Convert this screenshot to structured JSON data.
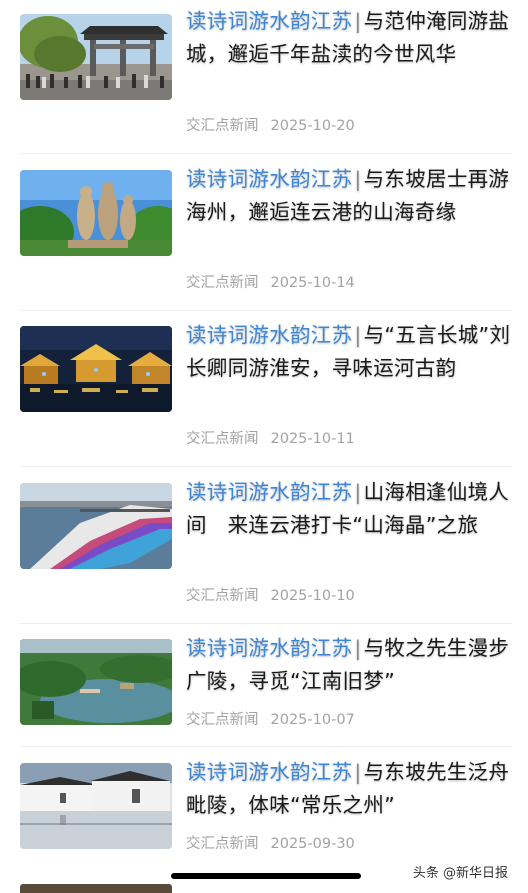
{
  "articles": [
    {
      "series": "读诗词游水韵江苏",
      "separator": "|",
      "title": "与范仲淹同游盐城，邂逅千年盐渎的今世风华",
      "source": "交汇点新闻",
      "date": "2025-10-20",
      "thumb_icon": "memorial-archway-image"
    },
    {
      "series": "读诗词游水韵江苏",
      "separator": "|",
      "title": "与东坡居士再游海州，邂逅连云港的山海奇缘",
      "source": "交汇点新闻",
      "date": "2025-10-14",
      "thumb_icon": "statue-park-image"
    },
    {
      "series": "读诗词游水韵江苏",
      "separator": "|",
      "title": "与“五言长城”刘长卿同游淮安，寻味运河古韵",
      "source": "交汇点新闻",
      "date": "2025-10-11",
      "thumb_icon": "night-canal-town-image"
    },
    {
      "series": "读诗词游水韵江苏",
      "separator": "|",
      "title": "山海相逢仙境人间　来连云港打卡“山海晶”之旅",
      "source": "交汇点新闻",
      "date": "2025-10-10",
      "thumb_icon": "coastal-boardwalk-image"
    },
    {
      "series": "读诗词游水韵江苏",
      "separator": "|",
      "title": "与牧之先生漫步广陵，寻觅“江南旧梦”",
      "source": "交汇点新闻",
      "date": "2025-10-07",
      "thumb_icon": "lake-garden-aerial-image"
    },
    {
      "series": "读诗词游水韵江苏",
      "separator": "|",
      "title": "与东坡先生泛舟毗陵，体味“常乐之州”",
      "source": "交汇点新闻",
      "date": "2025-09-30",
      "thumb_icon": "white-wall-architecture-image"
    }
  ],
  "watermark": "头条 @新华日报",
  "colors": {
    "series": "#3d86d6",
    "title": "#1a1a1a",
    "meta": "#a3a3a3"
  }
}
